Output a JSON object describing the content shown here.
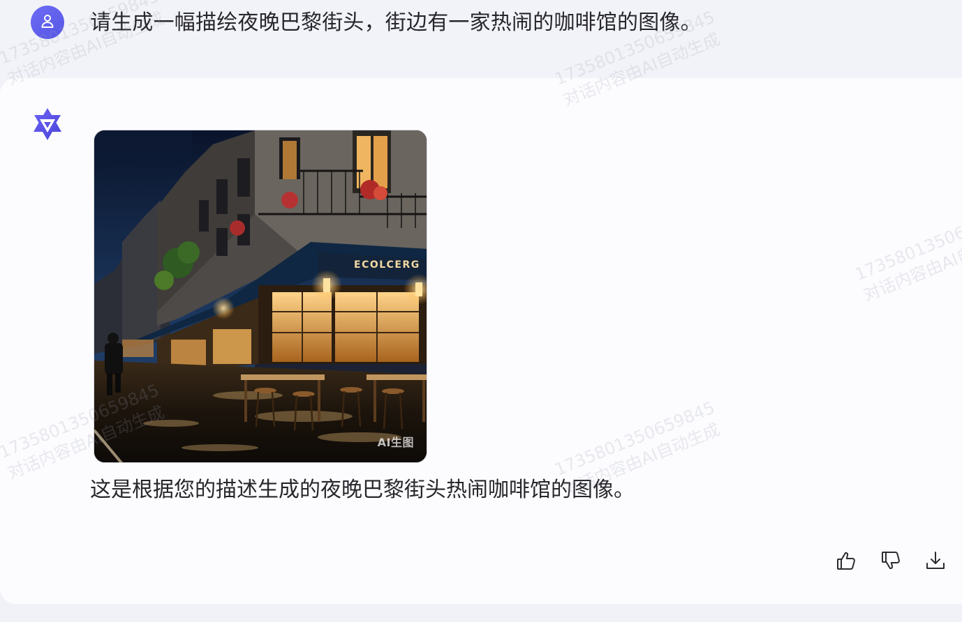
{
  "conversation": {
    "user_message": "请生成一幅描绘夜晚巴黎街头，街边有一家热闹的咖啡馆的图像。",
    "assistant_reply": "这是根据您的描述生成的夜晚巴黎街头热闹咖啡馆的图像。"
  },
  "generated_image": {
    "badge": "AI生图",
    "cafe_sign": "ECOLCERG"
  },
  "actions": {
    "like": "thumbs-up-icon",
    "dislike": "thumbs-down-icon",
    "download": "download-icon"
  },
  "watermark": {
    "number": "17358013506598​45",
    "text": "对话内容由AI自动生成"
  },
  "colors": {
    "avatar": "#5b5be8",
    "logo": "#5b54e8",
    "page_background": "#f1f2f7",
    "card_background": "#fcfcfe"
  }
}
